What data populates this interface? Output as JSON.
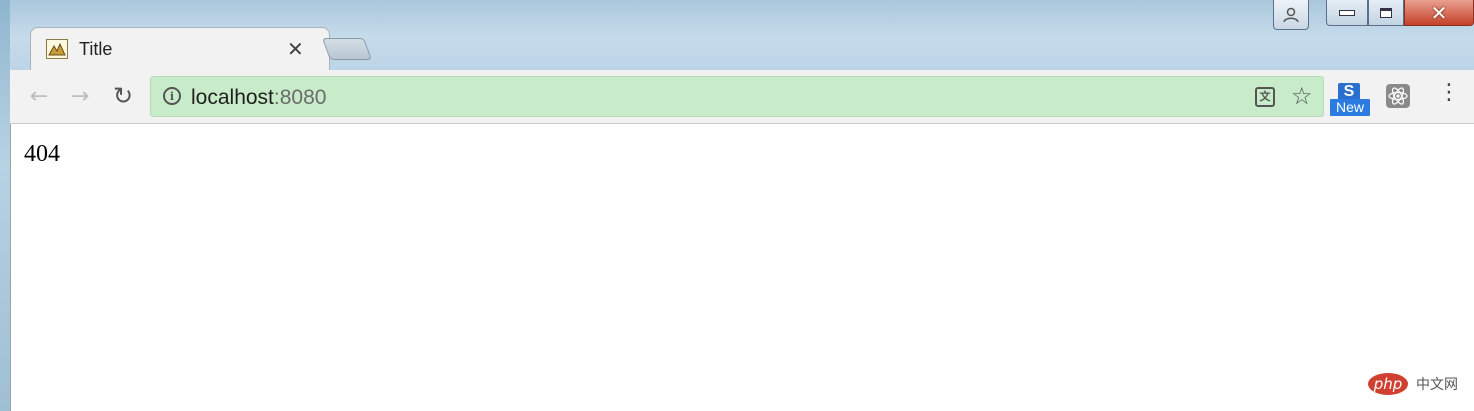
{
  "browser": {
    "tab": {
      "title": "Title"
    },
    "address_bar": {
      "host": "localhost",
      "port": ":8080"
    },
    "extensions": {
      "badge_letter": "S",
      "new_badge": "New"
    }
  },
  "page": {
    "body_text": "404"
  },
  "watermark": {
    "logo_text": "php",
    "site_text": "中文网"
  },
  "colors": {
    "omnibox_bg": "#c8ecc9",
    "close_button": "#c5412a",
    "extension_blue": "#2b7be0"
  },
  "icons": {
    "back": "arrow-left-icon",
    "forward": "arrow-right-icon",
    "reload": "reload-icon",
    "info": "info-icon",
    "translate": "translate-icon",
    "bookmark": "star-icon",
    "menu": "kebab-menu-icon"
  }
}
